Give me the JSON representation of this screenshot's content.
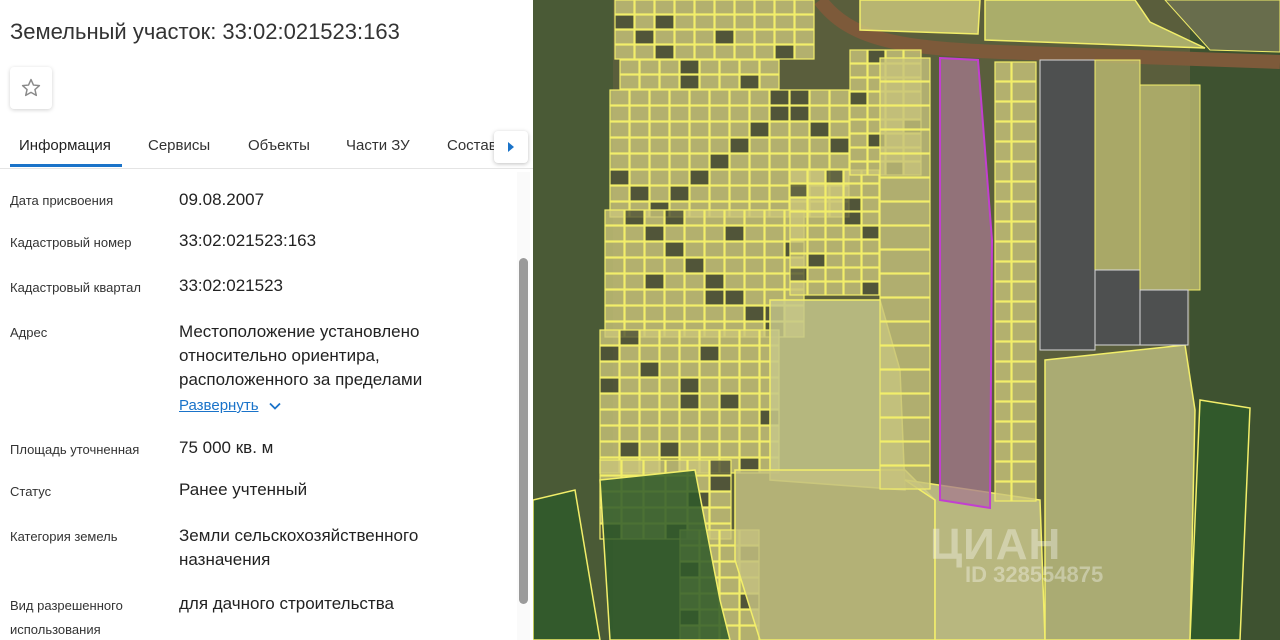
{
  "title": "Земельный участок: 33:02:021523:163",
  "favorite": {
    "icon": "star-outline-icon"
  },
  "tabs": [
    {
      "label": "Информация",
      "active": true
    },
    {
      "label": "Сервисы"
    },
    {
      "label": "Объекты"
    },
    {
      "label": "Части ЗУ"
    },
    {
      "label": "Состав"
    }
  ],
  "tabs_next_icon": "caret-right-icon",
  "fields": [
    {
      "label": "Дата присвоения",
      "value": "09.08.2007"
    },
    {
      "label": "Кадастровый номер",
      "value": "33:02:021523:163"
    },
    {
      "label": "Кадастровый квартал",
      "value": "33:02:021523"
    },
    {
      "label": "Адрес",
      "value": "Местоположение установлено относительно ориентира, расположенного за пределами",
      "expand_label": "Развернуть"
    },
    {
      "label": "Площадь уточненная",
      "value": "75 000 кв. м"
    },
    {
      "label": "Статус",
      "value": "Ранее учтенный"
    },
    {
      "label": "Категория земель",
      "value": "Земли сельскохозяйственного назначения"
    },
    {
      "label": "Вид разрешенного использования",
      "value": "для дачного строительства"
    }
  ],
  "map": {
    "watermark": "ЦИАН",
    "watermark_id": "ID 328554875",
    "colors": {
      "parcel_fill": "#c9c47a",
      "parcel_stroke": "#f2ee6a",
      "selected_stroke": "#c23fd0",
      "forest": "#2f5a2a",
      "road": "#7d5a3a"
    }
  }
}
